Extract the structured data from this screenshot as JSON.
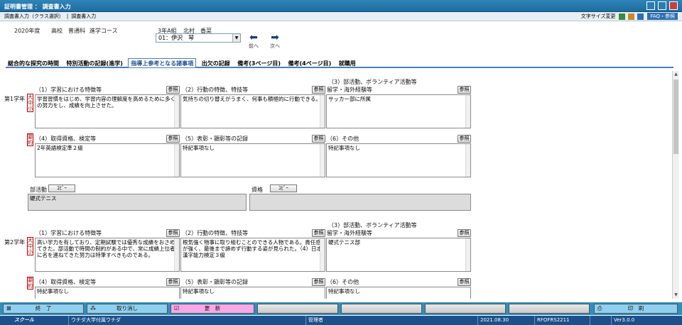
{
  "window": {
    "title": "証明書管理 ： 調査書入力"
  },
  "breadcrumb": {
    "items": [
      "調査書入力（クラス選択）",
      "調査書入力"
    ],
    "font_size_label": "文字サイズ変更",
    "faq_label": "FAQ・参照"
  },
  "header": {
    "year": "2020年度",
    "school": "高校",
    "course": "普通科",
    "subcourse": "進学コース",
    "class": "3年A組",
    "student_name": "北村　香菜",
    "selected": "01：伊沢　琴",
    "prev_label": "前へ",
    "next_label": "次へ"
  },
  "tabs": [
    {
      "label": "総合的な探究の時間"
    },
    {
      "label": "特別活動の記録(進学)"
    },
    {
      "label": "指導上参考となる諸事項"
    },
    {
      "label": "出欠の記録"
    },
    {
      "label": "備考(3ページ目)"
    },
    {
      "label": "備考(4ページ目)"
    },
    {
      "label": "就職用"
    }
  ],
  "common": {
    "ref": "参照",
    "copy": "ｺﾋﾟｰ"
  },
  "vtags": {
    "t1": [
      "大",
      "中",
      "小"
    ],
    "t2": [
      "要",
      "約"
    ]
  },
  "year1": {
    "label": "第1学年",
    "h1": "（1）学習における特徴等",
    "h2": "（2）行動の特徴、特技等",
    "h3": "（3）部活動、ボランティア活動等",
    "h3b": "留学・海外経験等",
    "t1": "学習習慣をはじめ、学習内容の理解度を高めるために多くの努力をし、成績を向上させた。",
    "t2": "気持ちの切り替えがうまく、何事も積極的に行動できる。",
    "t3": "サッカー部に所属",
    "h4": "（4）取得資格、検定等",
    "h5": "（5）表彰・顕彰等の記録",
    "h6": "（6）その他",
    "t4": "2年英語検定準２級",
    "t5": "特記事項なし",
    "t6": "特記事項なし",
    "club_label": "部活動",
    "club_value": "硬式テニス",
    "cert_label": "資格",
    "cert_value": ""
  },
  "year2": {
    "label": "第2学年",
    "h1": "（1）学習における特徴等",
    "h2": "（2）行動の特徴、特技等",
    "h3": "（3）部活動、ボランティア活動等",
    "h3b": "留学・海外経験等",
    "t1": "高い学力を有しており、定期試験では優秀な成績をおさめてきた。部活動で時間の制約がある中で、常に成績上位者に名を連ねてきた努力は特筆すべきものである。",
    "t2": "根気強く物事に取り組むことのできる人物である。責任感が強く、最後まで諦めず行動する姿が見られた。（4）日本漢字能力検定３級",
    "t3": "硬式テニス部",
    "h4": "（4）取得資格、検定等",
    "h5": "（5）表彰・顕彰等の記録",
    "h6": "（6）その他",
    "t4": "特記事項なし",
    "t5": "特記事項なし",
    "t6": "特記事項なし"
  },
  "fkeys": {
    "end": "終　了",
    "cancel": "取り消し",
    "update": "更　新",
    "print": "印　刷"
  },
  "status": {
    "app": "スクール",
    "school": "ウチダ大学付属ウチダ",
    "user": "管理者",
    "date": "2021.08.30",
    "code": "RFOFRS2211",
    "version": "Ver3.0.0"
  },
  "colors": {
    "title_bar": "#1e6c9f",
    "update_key": "#f7a8e6",
    "end_key": "#8fd0f0",
    "cancel_key": "#8fd0f0",
    "print_key": "#8fd0f0"
  }
}
